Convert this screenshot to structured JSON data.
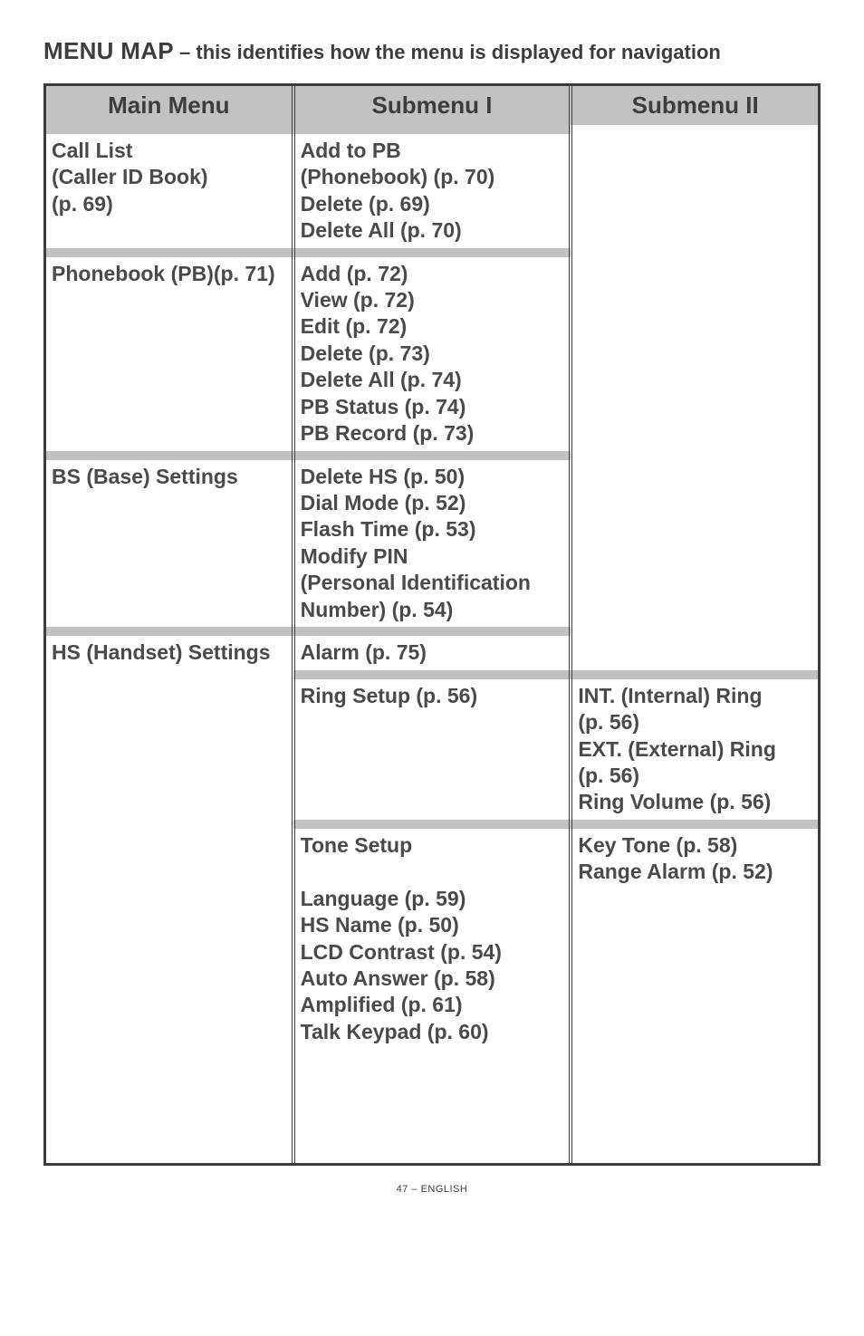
{
  "title": {
    "bold": "MENU MAP",
    "rest": " – this identifies how the menu is displayed for navigation"
  },
  "headers": {
    "main": "Main Menu",
    "sub1": "Submenu I",
    "sub2": "Submenu II"
  },
  "rows": {
    "r1": {
      "main": "Call List\n(Caller ID Book)\n(p. 69)",
      "sub1": "Add to PB\n(Phonebook) (p. 70)\nDelete (p. 69)\nDelete All (p. 70)",
      "sub2": ""
    },
    "r2": {
      "main": "Phonebook (PB)(p. 71)",
      "sub1": "Add (p. 72)\nView (p. 72)\nEdit (p. 72)\nDelete (p. 73)\nDelete All (p. 74)\nPB Status (p. 74)\nPB Record (p. 73)",
      "sub2": ""
    },
    "r3": {
      "main": "BS (Base) Settings",
      "sub1": "Delete HS (p. 50)\nDial Mode (p. 52)\nFlash Time (p. 53)\nModify PIN\n(Personal Identification\nNumber) (p. 54)",
      "sub2": ""
    },
    "r4a": {
      "main": "HS (Handset) Settings",
      "sub1": "Alarm (p. 75)",
      "sub2": ""
    },
    "r4b": {
      "main": "",
      "sub1": "Ring Setup (p. 56)",
      "sub2": "INT. (Internal) Ring\n(p. 56)\nEXT. (External) Ring\n(p. 56)\nRing Volume (p. 56)"
    },
    "r4c": {
      "main": "",
      "sub1": "Tone Setup\n\nLanguage (p. 59)\nHS Name (p. 50)\nLCD Contrast (p. 54)\nAuto Answer (p. 58)\nAmplified (p. 61)\nTalk Keypad (p. 60)",
      "sub2": "Key Tone (p. 58)\nRange Alarm (p. 52)"
    }
  },
  "footer": "47 – ENGLISH"
}
